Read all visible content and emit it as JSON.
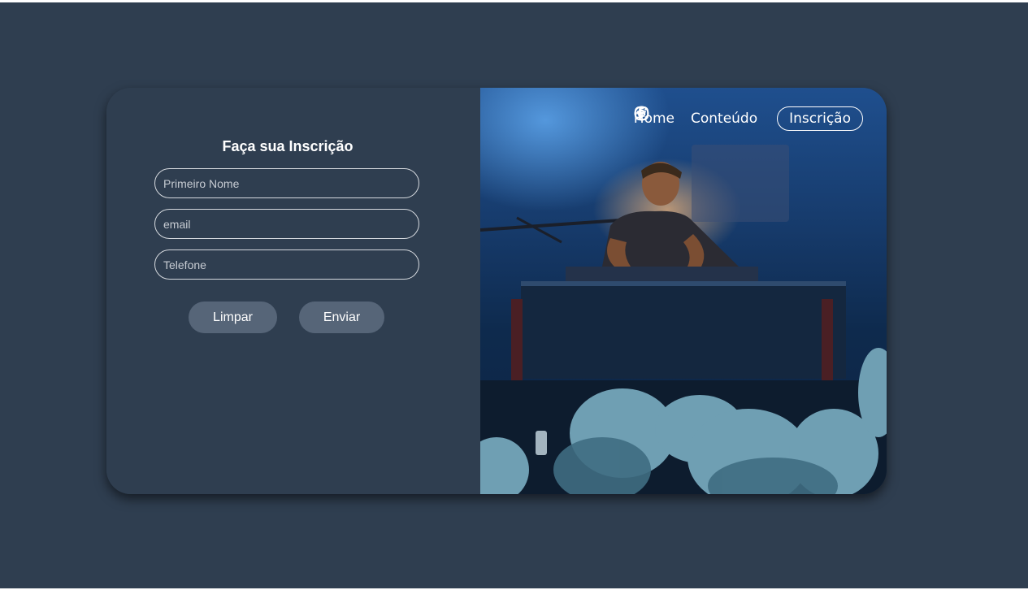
{
  "form": {
    "title": "Faça sua Inscrição",
    "first_name_placeholder": "Primeiro Nome",
    "email_placeholder": "email",
    "phone_placeholder": "Telefone",
    "clear_label": "Limpar",
    "send_label": "Enviar"
  },
  "nav": {
    "home_label": "Home",
    "content_label": "Conteúdo",
    "icons": [
      "instagram-icon",
      "facebook-icon",
      "spotify-icon"
    ],
    "signup_label": "Inscrição"
  },
  "colors": {
    "background": "#2f3e50",
    "button": "#566578",
    "text": "#ffffff"
  }
}
